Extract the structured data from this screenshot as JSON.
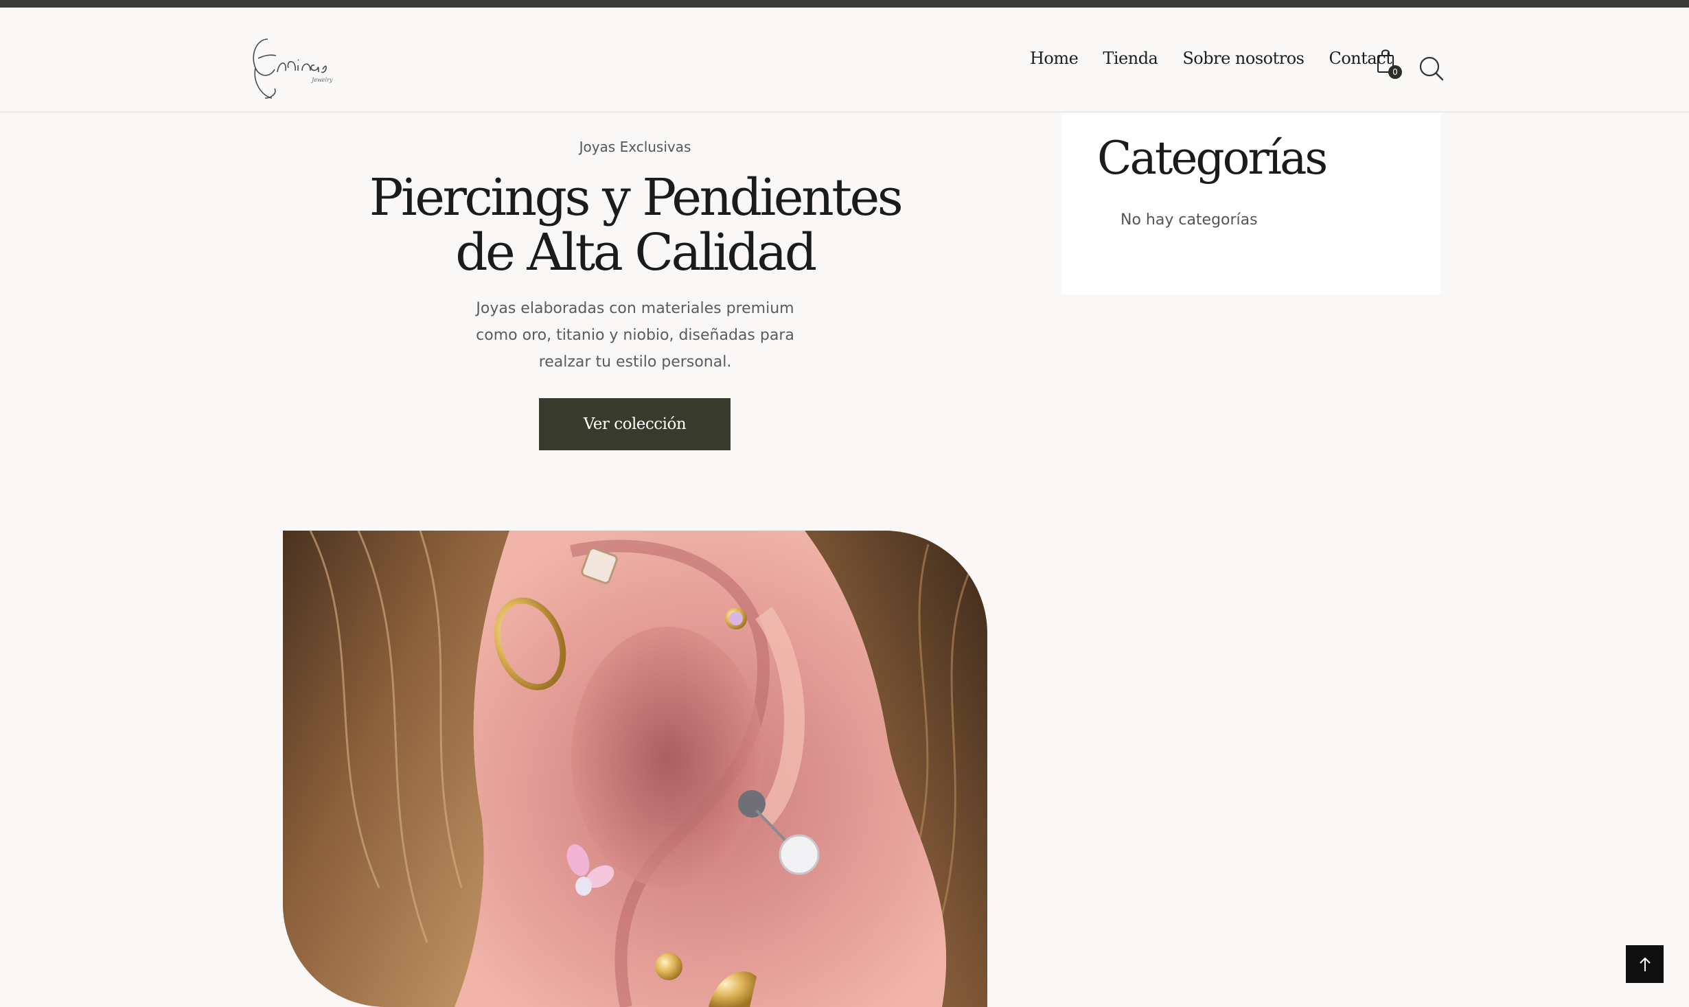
{
  "brand": {
    "logo_text": "Encinas",
    "logo_subtext": "Jewelry"
  },
  "nav": {
    "items": [
      "Home",
      "Tienda",
      "Sobre nosotros",
      "Contact"
    ]
  },
  "cart": {
    "count": "0",
    "icon": "shopping-bag-icon"
  },
  "search": {
    "icon": "search-icon"
  },
  "hero": {
    "eyebrow": "Joyas Exclusivas",
    "title": "Piercings y Pendientes de Alta Calidad",
    "description": "Joyas elaboradas con materiales premium como oro, titanio y niobio, diseñadas para realzar tu estilo personal.",
    "cta_label": "Ver colección"
  },
  "sidebar": {
    "title": "Categorías",
    "empty_text": "No hay categorías"
  },
  "colors": {
    "background": "#f9f8f6",
    "topbar": "#3a3a37",
    "button": "#383a2b",
    "back_to_top": "#0f0f0f"
  },
  "back_to_top": {
    "icon": "arrow-up-icon"
  }
}
